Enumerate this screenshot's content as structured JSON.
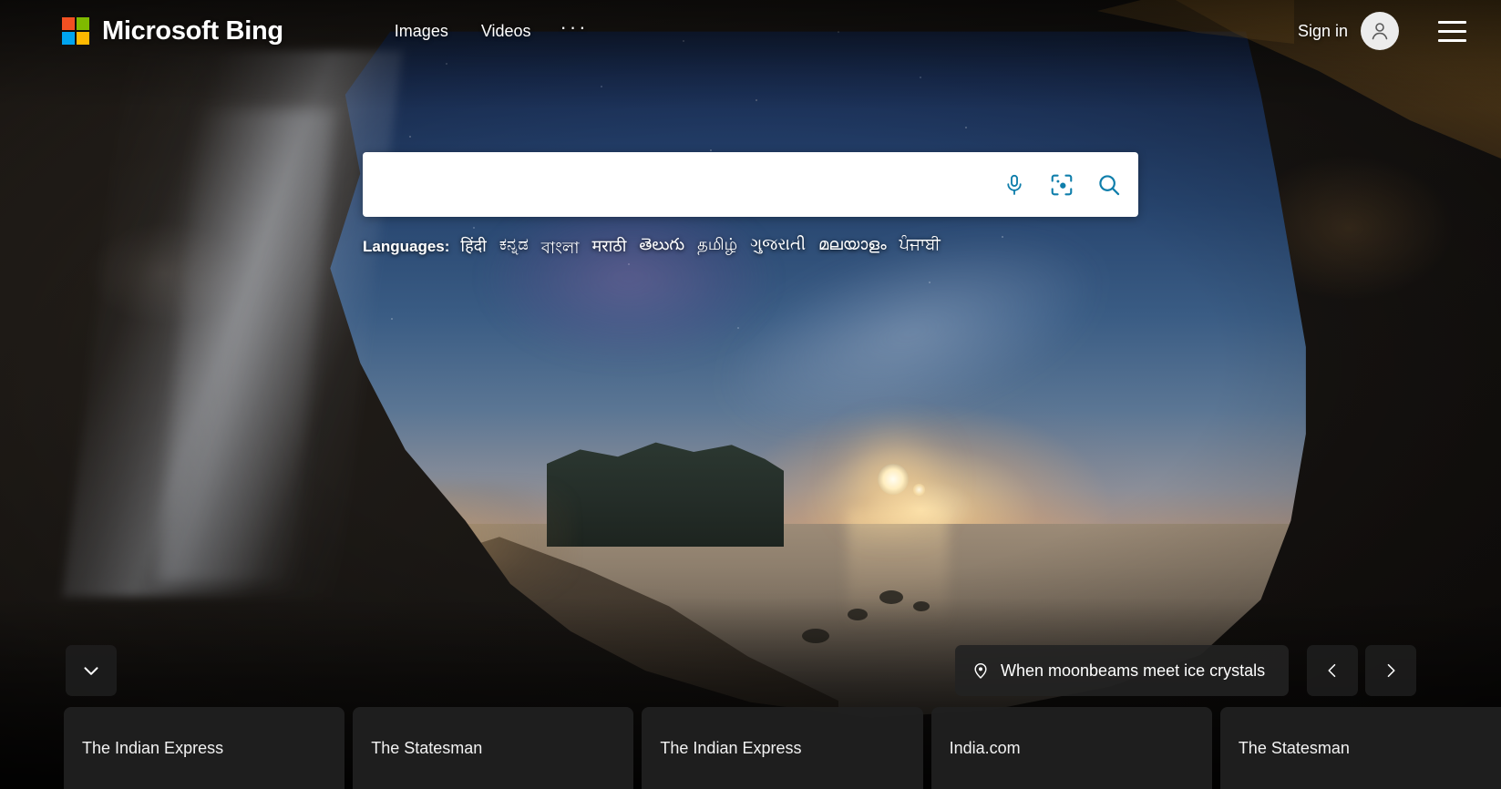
{
  "header": {
    "logo_text": "Microsoft Bing",
    "nav_links": [
      {
        "label": "Images"
      },
      {
        "label": "Videos"
      }
    ],
    "more_label": "···",
    "signin_label": "Sign in"
  },
  "search": {
    "value": "",
    "placeholder": "",
    "mic_icon": "microphone-icon",
    "lens_icon": "visual-search-icon",
    "search_icon": "search-icon",
    "accent_color": "#0f7eab"
  },
  "languages": {
    "label": "Languages:",
    "items": [
      {
        "label": "हिंदी"
      },
      {
        "label": "ಕನ್ನಡ"
      },
      {
        "label": "বাংলা"
      },
      {
        "label": "मराठी"
      },
      {
        "label": "తెలుగు"
      },
      {
        "label": "தமிழ்"
      },
      {
        "label": "ગુજરાતી"
      },
      {
        "label": "മലയാളം"
      },
      {
        "label": "ਪੰਜਾਬੀ"
      }
    ]
  },
  "image_info": {
    "caption": "When moonbeams meet ice crystals",
    "pin_icon": "location-pin-icon",
    "prev_label": "‹",
    "next_label": "›",
    "expand_icon": "chevron-down-icon"
  },
  "news": {
    "tiles": [
      {
        "label": "The Indian Express"
      },
      {
        "label": "The Statesman"
      },
      {
        "label": "The Indian Express"
      },
      {
        "label": "India.com"
      },
      {
        "label": "The Statesman"
      }
    ]
  },
  "brand_colors": {
    "red": "#F25022",
    "green": "#7FBA00",
    "blue": "#00A4EF",
    "yellow": "#FFB900"
  }
}
